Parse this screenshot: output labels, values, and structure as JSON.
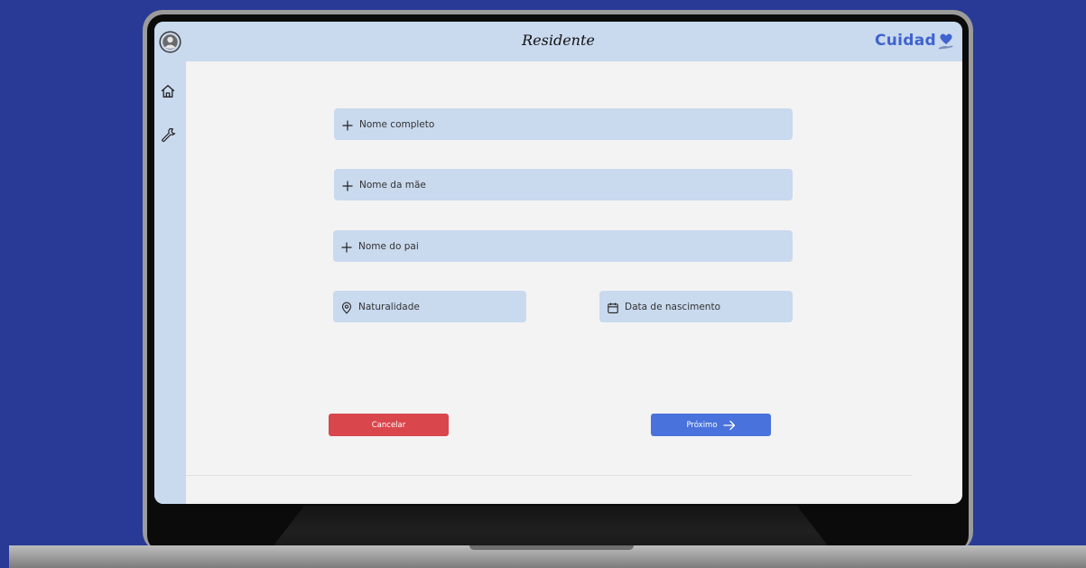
{
  "app": {
    "page_title": "Residente",
    "brand_name": "Cuidad",
    "brand_color": "#3f63cf"
  },
  "sidebar": {
    "items": [
      {
        "icon": "home-icon"
      },
      {
        "icon": "wrench-icon"
      }
    ]
  },
  "form": {
    "full_name": {
      "placeholder": "Nome completo",
      "icon": "plus-icon"
    },
    "mother_name": {
      "placeholder": "Nome da mãe",
      "icon": "plus-icon"
    },
    "father_name": {
      "placeholder": "Nome do pai",
      "icon": "plus-icon"
    },
    "birthplace": {
      "placeholder": "Naturalidade",
      "icon": "location-pin-icon"
    },
    "birth_date": {
      "placeholder": "Data de nascimento",
      "icon": "calendar-icon"
    }
  },
  "actions": {
    "cancel_label": "Cancelar",
    "cancel_color": "#d9464c",
    "next_label": "Próximo",
    "next_color": "#4a72dc"
  },
  "colors": {
    "background": "#283a96",
    "panel": "#c9d9ee",
    "screen": "#f3f3f4"
  }
}
